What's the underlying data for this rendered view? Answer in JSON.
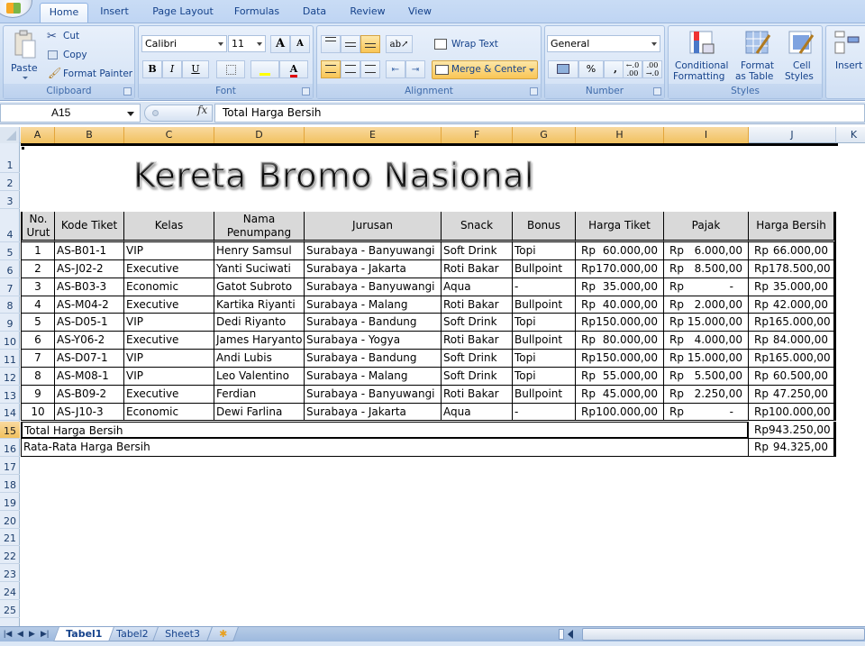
{
  "ribbon": {
    "tabs": [
      {
        "label": "Home",
        "active": true
      },
      {
        "label": "Insert"
      },
      {
        "label": "Page Layout"
      },
      {
        "label": "Formulas"
      },
      {
        "label": "Data"
      },
      {
        "label": "Review"
      },
      {
        "label": "View"
      }
    ],
    "clipboard": {
      "group_label": "Clipboard",
      "paste": "Paste",
      "cut": "Cut",
      "copy": "Copy",
      "format_painter": "Format Painter"
    },
    "font": {
      "group_label": "Font",
      "font_name": "Calibri",
      "font_size": "11",
      "bold": "B",
      "italic": "I",
      "underline": "U",
      "grow": "A",
      "shrink": "A",
      "font_color": "A"
    },
    "alignment": {
      "group_label": "Alignment",
      "wrap_text": "Wrap Text",
      "merge_center": "Merge & Center"
    },
    "number": {
      "group_label": "Number",
      "format": "General",
      "percent": "%",
      "comma": ","
    },
    "styles": {
      "group_label": "Styles",
      "conditional_1": "Conditional",
      "conditional_2": "Formatting",
      "format_table_1": "Format",
      "format_table_2": "as Table",
      "cell_styles_1": "Cell",
      "cell_styles_2": "Styles"
    },
    "cells": {
      "insert": "Insert"
    }
  },
  "formula_bar": {
    "name_box": "A15",
    "fx": "fx",
    "content": "Total Harga Bersih"
  },
  "columns": [
    "A",
    "B",
    "C",
    "D",
    "E",
    "F",
    "G",
    "H",
    "I",
    "J",
    "K"
  ],
  "selected_columns": [
    "A",
    "B",
    "C",
    "D",
    "E",
    "F",
    "G",
    "H",
    "I"
  ],
  "rows": [
    "1",
    "2",
    "3",
    "4",
    "5",
    "6",
    "7",
    "8",
    "9",
    "10",
    "11",
    "12",
    "13",
    "14",
    "15",
    "16",
    "17",
    "18",
    "19",
    "20",
    "21",
    "22",
    "23",
    "24",
    "25"
  ],
  "selected_row": "15",
  "sheet": {
    "title": "Kereta Bromo Nasional",
    "headers": [
      "No. Urut",
      "Kode Tiket",
      "Kelas",
      "Nama Penumpang",
      "Jurusan",
      "Snack",
      "Bonus",
      "Harga Tiket",
      "Pajak",
      "Harga Bersih"
    ],
    "header_no_1": "No.",
    "header_no_2": "Urut",
    "header_nama_1": "Nama",
    "header_nama_2": "Penumpang",
    "currency": "Rp",
    "data": [
      {
        "no": "1",
        "kode": "AS-B01-1",
        "kelas": "VIP",
        "nama": "Henry Samsul",
        "jurusan": "Surabaya - Banyuwangi",
        "snack": "Soft Drink",
        "bonus": "Topi",
        "harga": "60.000,00",
        "pajak": "6.000,00",
        "bersih": "66.000,00"
      },
      {
        "no": "2",
        "kode": "AS-J02-2",
        "kelas": "Executive",
        "nama": "Yanti Suciwati",
        "jurusan": "Surabaya - Jakarta",
        "snack": "Roti Bakar",
        "bonus": "Bullpoint",
        "harga": "170.000,00",
        "pajak": "8.500,00",
        "bersih": "178.500,00"
      },
      {
        "no": "3",
        "kode": "AS-B03-3",
        "kelas": "Economic",
        "nama": "Gatot Subroto",
        "jurusan": "Surabaya - Banyuwangi",
        "snack": "Aqua",
        "bonus": "-",
        "harga": "35.000,00",
        "pajak": "-",
        "bersih": "35.000,00"
      },
      {
        "no": "4",
        "kode": "AS-M04-2",
        "kelas": "Executive",
        "nama": "Kartika Riyanti",
        "jurusan": "Surabaya - Malang",
        "snack": "Roti Bakar",
        "bonus": "Bullpoint",
        "harga": "40.000,00",
        "pajak": "2.000,00",
        "bersih": "42.000,00"
      },
      {
        "no": "5",
        "kode": "AS-D05-1",
        "kelas": "VIP",
        "nama": "Dedi Riyanto",
        "jurusan": "Surabaya - Bandung",
        "snack": "Soft Drink",
        "bonus": "Topi",
        "harga": "150.000,00",
        "pajak": "15.000,00",
        "bersih": "165.000,00"
      },
      {
        "no": "6",
        "kode": "AS-Y06-2",
        "kelas": "Executive",
        "nama": "James Haryanto",
        "jurusan": "Surabaya - Yogya",
        "snack": "Roti Bakar",
        "bonus": "Bullpoint",
        "harga": "80.000,00",
        "pajak": "4.000,00",
        "bersih": "84.000,00"
      },
      {
        "no": "7",
        "kode": "AS-D07-1",
        "kelas": "VIP",
        "nama": "Andi Lubis",
        "jurusan": "Surabaya - Bandung",
        "snack": "Soft Drink",
        "bonus": "Topi",
        "harga": "150.000,00",
        "pajak": "15.000,00",
        "bersih": "165.000,00"
      },
      {
        "no": "8",
        "kode": "AS-M08-1",
        "kelas": "VIP",
        "nama": "Leo Valentino",
        "jurusan": "Surabaya - Malang",
        "snack": "Soft Drink",
        "bonus": "Topi",
        "harga": "55.000,00",
        "pajak": "5.500,00",
        "bersih": "60.500,00"
      },
      {
        "no": "9",
        "kode": "AS-B09-2",
        "kelas": "Executive",
        "nama": "Ferdian",
        "jurusan": "Surabaya - Banyuwangi",
        "snack": "Roti Bakar",
        "bonus": "Bullpoint",
        "harga": "45.000,00",
        "pajak": "2.250,00",
        "bersih": "47.250,00"
      },
      {
        "no": "10",
        "kode": "AS-J10-3",
        "kelas": "Economic",
        "nama": "Dewi Farlina",
        "jurusan": "Surabaya - Jakarta",
        "snack": "Aqua",
        "bonus": "-",
        "harga": "100.000,00",
        "pajak": "-",
        "bersih": "100.000,00"
      }
    ],
    "total_label": "Total Harga Bersih",
    "total_value": "943.250,00",
    "average_label": "Rata-Rata Harga Bersih",
    "average_value": "94.325,00"
  },
  "sheet_tabs": [
    {
      "label": "Tabel1",
      "active": true
    },
    {
      "label": "Tabel2"
    },
    {
      "label": "Sheet3"
    }
  ],
  "colors": {
    "selection_header": "#f1c15f",
    "table_header_fill": "#d9d9d9",
    "ribbon_blue": "#c6d9f1"
  }
}
